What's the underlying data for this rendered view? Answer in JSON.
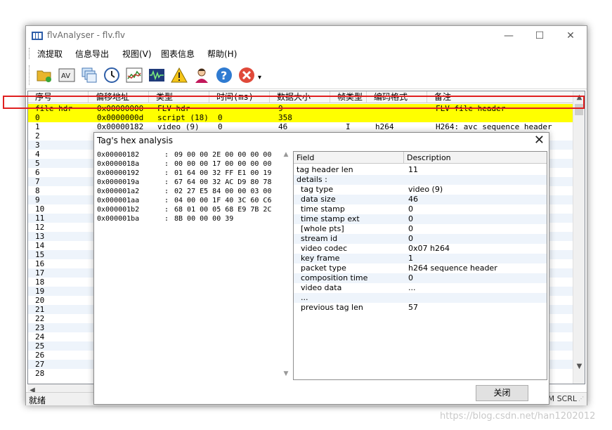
{
  "window": {
    "title": "flvAnalyser - flv.flv",
    "minimize_glyph": "—",
    "maximize_glyph": "☐",
    "close_glyph": "✕"
  },
  "menu": [
    {
      "label": "流提取"
    },
    {
      "label": "信息导出"
    },
    {
      "label": "视图(V)"
    },
    {
      "label": "图表信息"
    },
    {
      "label": "帮助(H)"
    }
  ],
  "toolbar": {
    "icons": [
      "open-folder-icon",
      "av-icon",
      "windows-icon",
      "clock-icon",
      "chart-icon",
      "waveform-icon",
      "warning-icon",
      "user-icon",
      "help-icon",
      "stop-icon"
    ],
    "dropdown_glyph": "▾"
  },
  "list": {
    "columns": [
      "序号",
      "偏移地址",
      "类型",
      "时间(ms)",
      "数据大小",
      "帧类型",
      "编码格式",
      "备注"
    ],
    "rows": [
      {
        "c": [
          "file hdr",
          "0x00000000",
          "FLV hdr",
          "",
          "9",
          "",
          "",
          "FLV file header"
        ],
        "style": "hdr"
      },
      {
        "c": [
          "0",
          "0x0000000d",
          "script (18)",
          "0",
          "358",
          "",
          "",
          ""
        ],
        "style": "hdr"
      },
      {
        "c": [
          "1",
          "0x00000182",
          "video (9)",
          "0",
          "46",
          "I",
          "h264",
          "H264: avc sequence header"
        ],
        "style": "plain"
      },
      {
        "c": [
          "2"
        ]
      },
      {
        "c": [
          "3"
        ]
      },
      {
        "c": [
          "4"
        ]
      },
      {
        "c": [
          "5"
        ]
      },
      {
        "c": [
          "6"
        ]
      },
      {
        "c": [
          "7"
        ]
      },
      {
        "c": [
          "8"
        ]
      },
      {
        "c": [
          "9"
        ]
      },
      {
        "c": [
          "10"
        ]
      },
      {
        "c": [
          "11"
        ]
      },
      {
        "c": [
          "12"
        ]
      },
      {
        "c": [
          "13"
        ]
      },
      {
        "c": [
          "14"
        ]
      },
      {
        "c": [
          "15"
        ]
      },
      {
        "c": [
          "16"
        ]
      },
      {
        "c": [
          "17"
        ]
      },
      {
        "c": [
          "18"
        ]
      },
      {
        "c": [
          "19"
        ]
      },
      {
        "c": [
          "20"
        ]
      },
      {
        "c": [
          "21"
        ]
      },
      {
        "c": [
          "22"
        ]
      },
      {
        "c": [
          "23"
        ]
      },
      {
        "c": [
          "24"
        ]
      },
      {
        "c": [
          "25"
        ]
      },
      {
        "c": [
          "26"
        ]
      },
      {
        "c": [
          "27"
        ]
      },
      {
        "c": [
          "28"
        ]
      }
    ]
  },
  "status": {
    "text": "就绪",
    "scrl": "M SCRL"
  },
  "dialog": {
    "title": "Tag's hex analysis",
    "close_glyph": "✕",
    "hex_lines": [
      {
        "addr": "0x00000182",
        "bytes": "09 00 00 2E 00 00 00 00"
      },
      {
        "addr": "0x0000018a",
        "bytes": "00 00 00 17 00 00 00 00"
      },
      {
        "addr": "0x00000192",
        "bytes": "01 64 00 32 FF E1 00 19"
      },
      {
        "addr": "0x0000019a",
        "bytes": "67 64 00 32 AC D9 80 78"
      },
      {
        "addr": "0x000001a2",
        "bytes": "02 27 E5 84 00 00 03 00"
      },
      {
        "addr": "0x000001aa",
        "bytes": "04 00 00 1F 40 3C 60 C6"
      },
      {
        "addr": "0x000001b2",
        "bytes": "68 01 00 05 68 E9 7B 2C"
      },
      {
        "addr": "0x000001ba",
        "bytes": "8B 00 00 00 39"
      }
    ],
    "hex_sep": ":",
    "field_columns": [
      "Field",
      "Description"
    ],
    "fields": [
      {
        "f": "tag header len",
        "d": "11",
        "indent": 0
      },
      {
        "f": "details :",
        "d": "",
        "indent": 0
      },
      {
        "f": "tag type",
        "d": "video (9)",
        "indent": 1
      },
      {
        "f": "data size",
        "d": "46",
        "indent": 1
      },
      {
        "f": "time stamp",
        "d": "0",
        "indent": 1
      },
      {
        "f": "time stamp ext",
        "d": "0",
        "indent": 1
      },
      {
        "f": "[whole pts]",
        "d": "0",
        "indent": 1
      },
      {
        "f": "stream id",
        "d": "0",
        "indent": 1
      },
      {
        "f": "video codec",
        "d": "0x07  h264",
        "indent": 1
      },
      {
        "f": "key frame",
        "d": "1",
        "indent": 1
      },
      {
        "f": "packet type",
        "d": "h264 sequence header",
        "indent": 1
      },
      {
        "f": "composition time",
        "d": "0",
        "indent": 1
      },
      {
        "f": "video data",
        "d": "...",
        "indent": 1
      },
      {
        "f": "...",
        "d": "",
        "indent": 1
      },
      {
        "f": "previous tag len",
        "d": "57",
        "indent": 1
      }
    ],
    "button_label": "关闭"
  },
  "watermark": "https://blog.csdn.net/han1202012"
}
